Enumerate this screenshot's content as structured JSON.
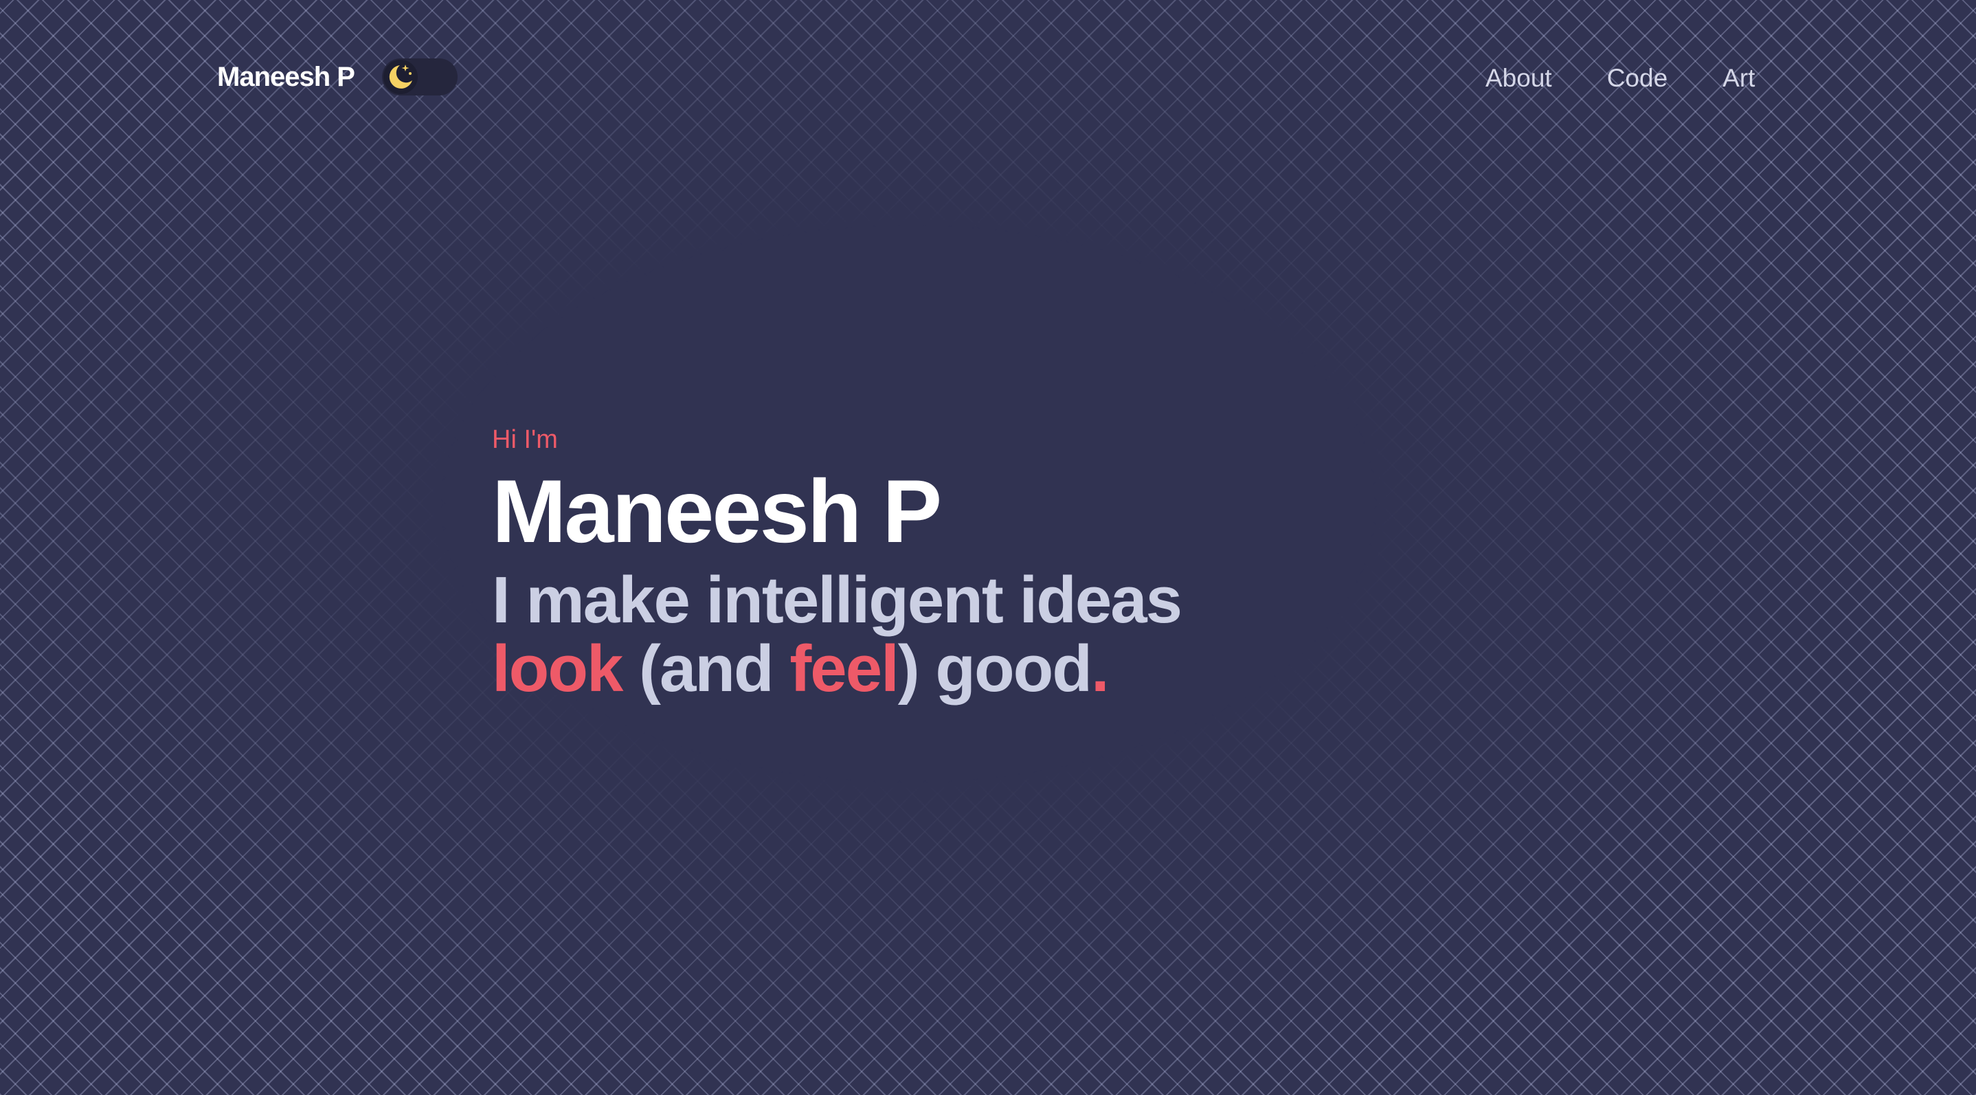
{
  "header": {
    "brand": "Maneesh P",
    "theme_toggle_icon": "moon-stars-icon",
    "nav": [
      {
        "label": "About"
      },
      {
        "label": "Code"
      },
      {
        "label": "Art"
      }
    ]
  },
  "hero": {
    "greeting": "Hi I'm",
    "name": "Maneesh P",
    "tagline_line1": "I make intelligent ideas",
    "tagline_line2": {
      "look": "look",
      "paren_open_and": " (and ",
      "feel": "feel",
      "paren_close_good": ") good",
      "period": "."
    }
  },
  "colors": {
    "background": "#313352",
    "accent": "#ee5a68",
    "heading": "#ffffff",
    "tagline": "#cbcfe3",
    "nav_text": "#d5d7e8",
    "moon": "#f5d163"
  }
}
